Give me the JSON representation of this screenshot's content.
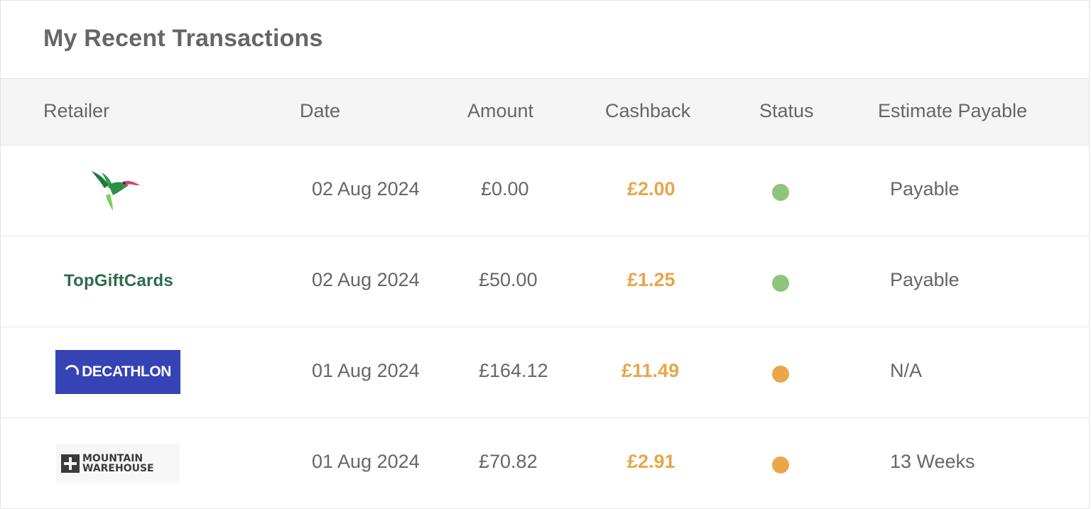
{
  "title": "My Recent Transactions",
  "columns": {
    "retailer": "Retailer",
    "date": "Date",
    "amount": "Amount",
    "cashback": "Cashback",
    "status": "Status",
    "estimate": "Estimate Payable"
  },
  "rows": [
    {
      "retailer_logo": "hummingbird-logo",
      "retailer": "",
      "date": "02 Aug 2024",
      "amount": "£0.00",
      "cashback": "£2.00",
      "status_color": "#8dc47e",
      "estimate": "Payable"
    },
    {
      "retailer_logo": "topgiftcards-logo",
      "retailer": "TopGiftCards",
      "date": "02 Aug 2024",
      "amount": "£50.00",
      "cashback": "£1.25",
      "status_color": "#8dc47e",
      "estimate": "Payable"
    },
    {
      "retailer_logo": "decathlon-logo",
      "retailer": "DECATHLON",
      "date": "01 Aug 2024",
      "amount": "£164.12",
      "cashback": "£11.49",
      "status_color": "#eaa74a",
      "estimate": "N/A"
    },
    {
      "retailer_logo": "mountain-warehouse-logo",
      "retailer": "MOUNTAIN WAREHOUSE",
      "date": "01 Aug 2024",
      "amount": "£70.82",
      "cashback": "£2.91",
      "status_color": "#eaa74a",
      "estimate": "13 Weeks"
    }
  ],
  "colors": {
    "cashback": "#e8a64a",
    "header_bg": "#f5f5f5"
  }
}
